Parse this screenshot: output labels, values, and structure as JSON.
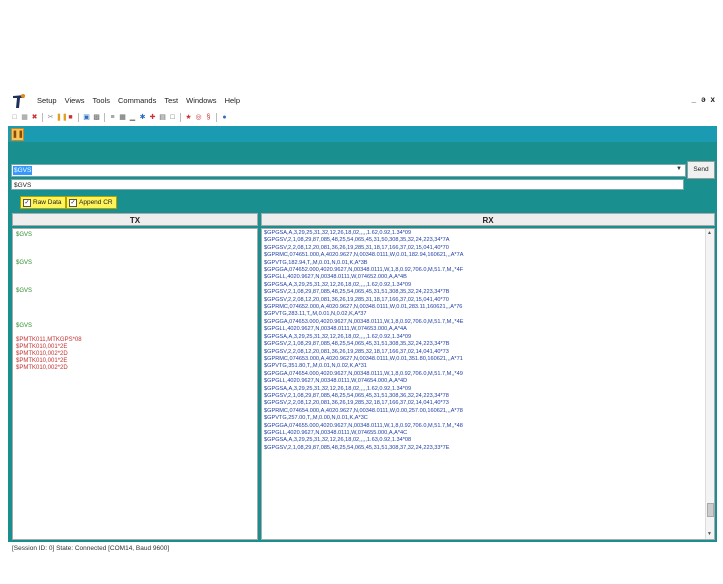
{
  "app": {
    "menu": [
      "Setup",
      "Views",
      "Tools",
      "Commands",
      "Test",
      "Windows",
      "Help"
    ],
    "window_controls": {
      "minimize": "_",
      "restore": "ə",
      "close": "x"
    }
  },
  "toolbar": {
    "icons": [
      "new-icon",
      "open-icon",
      "delete-icon",
      "cut-icon",
      "pause-icon",
      "stop-icon",
      "save-icon",
      "print-icon",
      "list-icon",
      "grid-icon",
      "chart-icon",
      "star-icon",
      "pin-icon",
      "table-icon",
      "window-icon",
      "antenna-icon",
      "gps-icon",
      "satellite-icon",
      "help-icon"
    ]
  },
  "colors": {
    "accent": "#1a9bb2",
    "panel": "#1a8f8f",
    "tx_green": "#2e8b2e",
    "tx_red": "#c23030",
    "rx_blue": "#1f3fa6",
    "option_yellow": "#fff35a"
  },
  "command": {
    "value": "$GVS",
    "send_label": "Send",
    "echo": "$GVS"
  },
  "options": {
    "raw_data": "Raw Data",
    "append_cr": "Append CR"
  },
  "tx": {
    "header": "TX",
    "lines": [
      {
        "text": "$GVS",
        "color": "green",
        "row": 0
      },
      {
        "text": "$GVS",
        "color": "green",
        "row": 4
      },
      {
        "text": "$GVS",
        "color": "green",
        "row": 8
      },
      {
        "text": "$GVS",
        "color": "green",
        "row": 13
      },
      {
        "text": "$PMTK011,MTKGPS*08",
        "color": "red",
        "row": 15
      },
      {
        "text": "$PMTK010,001*2E",
        "color": "red",
        "row": 16
      },
      {
        "text": "$PMTK010,002*2D",
        "color": "red",
        "row": 17
      },
      {
        "text": "$PMTK010,001*2E",
        "color": "red",
        "row": 18
      },
      {
        "text": "$PMTK010,002*2D",
        "color": "red",
        "row": 19
      }
    ]
  },
  "rx": {
    "header": "RX",
    "lines": [
      "$GPGSA,A,3,29,25,31,32,12,26,18,02,,,,,1.62,0.92,1.34*09",
      "$GPGSV,2,1,08,29,87,085,48,25,54,065,45,31,50,308,35,32,24,223,34*7A",
      "$GPGSV,2,2,08,12,20,081,36,26,19,285,31,18,17,166,37,02,15,041,40*70",
      "$GPRMC,074651.000,A,4020.9627,N,00348.0111,W,0.01,182.94,160621,,,A*7A",
      "$GPVTG,182.94,T,,M,0.01,N,0.01,K,A*3B",
      "$GPGGA,074652.000,4020.9627,N,00348.0111,W,1,8,0.92,706.0,M,51.7,M,,*4F",
      "$GPGLL,4020.9627,N,00348.0111,W,074652.000,A,A*4B",
      "$GPGSA,A,3,29,25,31,32,12,26,18,02,,,,,1.62,0.92,1.34*09",
      "$GPGSV,2,1,08,29,87,085,48,25,54,065,45,31,51,308,35,32,24,223,34*7B",
      "$GPGSV,2,2,08,12,20,081,36,26,19,285,31,18,17,166,37,02,15,041,40*70",
      "$GPRMC,074652.000,A,4020.9627,N,00348.0111,W,0.01,283.11,160621,,,A*76",
      "$GPVTG,283.11,T,,M,0.01,N,0.02,K,A*37",
      "$GPGGA,074653.000,4020.9627,N,00348.0111,W,1,8,0.92,706.0,M,51.7,M,,*4E",
      "$GPGLL,4020.9627,N,00348.0111,W,074653.000,A,A*4A",
      "$GPGSA,A,3,29,25,31,32,12,26,18,02,,,,,1.62,0.92,1.34*09",
      "$GPGSV,2,1,08,29,87,085,48,25,54,065,45,31,51,308,35,32,24,223,34*7B",
      "$GPGSV,2,2,08,12,20,081,36,26,19,285,32,18,17,166,37,02,14,041,40*73",
      "$GPRMC,074653.000,A,4020.9627,N,00348.0111,W,0.01,351.80,160621,,,A*71",
      "$GPVTG,351.80,T,,M,0.01,N,0.02,K,A*31",
      "$GPGGA,074654.000,4020.9627,N,00348.0111,W,1,8,0.92,706.0,M,51.7,M,,*49",
      "$GPGLL,4020.9627,N,00348.0111,W,074654.000,A,A*4D",
      "$GPGSA,A,3,29,25,31,32,12,26,18,02,,,,,1.62,0.92,1.34*09",
      "$GPGSV,2,1,08,29,87,085,48,25,54,065,45,31,51,308,36,32,24,223,34*78",
      "$GPGSV,2,2,08,12,20,081,36,26,19,285,32,18,17,166,37,02,14,041,40*73",
      "$GPRMC,074654.000,A,4020.9627,N,00348.0111,W,0.00,257.00,160621,,,A*78",
      "$GPVTG,257.00,T,,M,0.00,N,0.01,K,A*3C",
      "$GPGGA,074655.000,4020.9627,N,00348.0111,W,1,8,0.92,706.0,M,51.7,M,,*48",
      "$GPGLL,4020.9627,N,00348.0111,W,074655.000,A,A*4C",
      "$GPGSA,A,3,29,25,31,32,12,26,18,02,,,,,1.63,0.92,1.34*08",
      "$GPGSV,2,1,08,29,87,085,48,25,54,065,45,31,51,308,37,32,24,223,33*7E"
    ]
  },
  "status": "[Session ID: 0] State: Connected [COM14, Baud 9600]"
}
